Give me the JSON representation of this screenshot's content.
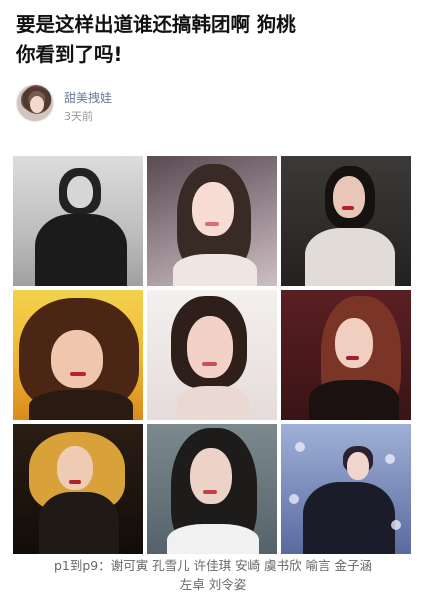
{
  "article": {
    "title_line1": "要是这样出道谁还搞韩团啊 狗桃",
    "title_line2": "你看到了吗!"
  },
  "author": {
    "name": "甜美拽娃",
    "time": "3天前"
  },
  "gallery": {
    "caption_line1": "p1到p9：谢可寅 孔雪儿 许佳琪 安崎 虞书欣 喻言 金子涵",
    "caption_line2": "左卓 刘令姿"
  }
}
